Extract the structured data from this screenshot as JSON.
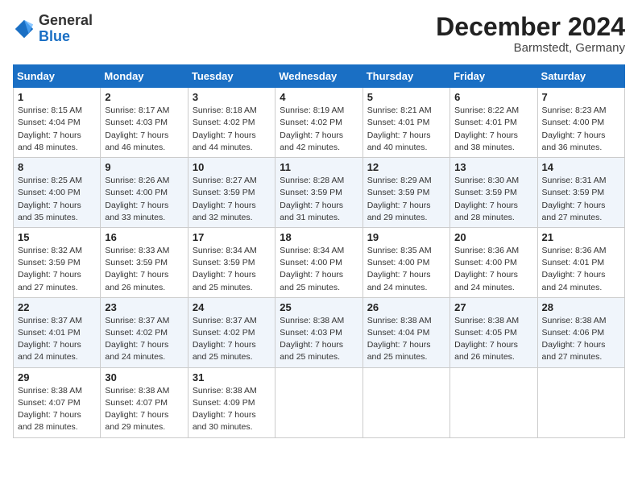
{
  "header": {
    "logo_general": "General",
    "logo_blue": "Blue",
    "month_title": "December 2024",
    "location": "Barmstedt, Germany"
  },
  "columns": [
    "Sunday",
    "Monday",
    "Tuesday",
    "Wednesday",
    "Thursday",
    "Friday",
    "Saturday"
  ],
  "weeks": [
    [
      {
        "day": "1",
        "sunrise": "Sunrise: 8:15 AM",
        "sunset": "Sunset: 4:04 PM",
        "daylight": "Daylight: 7 hours and 48 minutes."
      },
      {
        "day": "2",
        "sunrise": "Sunrise: 8:17 AM",
        "sunset": "Sunset: 4:03 PM",
        "daylight": "Daylight: 7 hours and 46 minutes."
      },
      {
        "day": "3",
        "sunrise": "Sunrise: 8:18 AM",
        "sunset": "Sunset: 4:02 PM",
        "daylight": "Daylight: 7 hours and 44 minutes."
      },
      {
        "day": "4",
        "sunrise": "Sunrise: 8:19 AM",
        "sunset": "Sunset: 4:02 PM",
        "daylight": "Daylight: 7 hours and 42 minutes."
      },
      {
        "day": "5",
        "sunrise": "Sunrise: 8:21 AM",
        "sunset": "Sunset: 4:01 PM",
        "daylight": "Daylight: 7 hours and 40 minutes."
      },
      {
        "day": "6",
        "sunrise": "Sunrise: 8:22 AM",
        "sunset": "Sunset: 4:01 PM",
        "daylight": "Daylight: 7 hours and 38 minutes."
      },
      {
        "day": "7",
        "sunrise": "Sunrise: 8:23 AM",
        "sunset": "Sunset: 4:00 PM",
        "daylight": "Daylight: 7 hours and 36 minutes."
      }
    ],
    [
      {
        "day": "8",
        "sunrise": "Sunrise: 8:25 AM",
        "sunset": "Sunset: 4:00 PM",
        "daylight": "Daylight: 7 hours and 35 minutes."
      },
      {
        "day": "9",
        "sunrise": "Sunrise: 8:26 AM",
        "sunset": "Sunset: 4:00 PM",
        "daylight": "Daylight: 7 hours and 33 minutes."
      },
      {
        "day": "10",
        "sunrise": "Sunrise: 8:27 AM",
        "sunset": "Sunset: 3:59 PM",
        "daylight": "Daylight: 7 hours and 32 minutes."
      },
      {
        "day": "11",
        "sunrise": "Sunrise: 8:28 AM",
        "sunset": "Sunset: 3:59 PM",
        "daylight": "Daylight: 7 hours and 31 minutes."
      },
      {
        "day": "12",
        "sunrise": "Sunrise: 8:29 AM",
        "sunset": "Sunset: 3:59 PM",
        "daylight": "Daylight: 7 hours and 29 minutes."
      },
      {
        "day": "13",
        "sunrise": "Sunrise: 8:30 AM",
        "sunset": "Sunset: 3:59 PM",
        "daylight": "Daylight: 7 hours and 28 minutes."
      },
      {
        "day": "14",
        "sunrise": "Sunrise: 8:31 AM",
        "sunset": "Sunset: 3:59 PM",
        "daylight": "Daylight: 7 hours and 27 minutes."
      }
    ],
    [
      {
        "day": "15",
        "sunrise": "Sunrise: 8:32 AM",
        "sunset": "Sunset: 3:59 PM",
        "daylight": "Daylight: 7 hours and 27 minutes."
      },
      {
        "day": "16",
        "sunrise": "Sunrise: 8:33 AM",
        "sunset": "Sunset: 3:59 PM",
        "daylight": "Daylight: 7 hours and 26 minutes."
      },
      {
        "day": "17",
        "sunrise": "Sunrise: 8:34 AM",
        "sunset": "Sunset: 3:59 PM",
        "daylight": "Daylight: 7 hours and 25 minutes."
      },
      {
        "day": "18",
        "sunrise": "Sunrise: 8:34 AM",
        "sunset": "Sunset: 4:00 PM",
        "daylight": "Daylight: 7 hours and 25 minutes."
      },
      {
        "day": "19",
        "sunrise": "Sunrise: 8:35 AM",
        "sunset": "Sunset: 4:00 PM",
        "daylight": "Daylight: 7 hours and 24 minutes."
      },
      {
        "day": "20",
        "sunrise": "Sunrise: 8:36 AM",
        "sunset": "Sunset: 4:00 PM",
        "daylight": "Daylight: 7 hours and 24 minutes."
      },
      {
        "day": "21",
        "sunrise": "Sunrise: 8:36 AM",
        "sunset": "Sunset: 4:01 PM",
        "daylight": "Daylight: 7 hours and 24 minutes."
      }
    ],
    [
      {
        "day": "22",
        "sunrise": "Sunrise: 8:37 AM",
        "sunset": "Sunset: 4:01 PM",
        "daylight": "Daylight: 7 hours and 24 minutes."
      },
      {
        "day": "23",
        "sunrise": "Sunrise: 8:37 AM",
        "sunset": "Sunset: 4:02 PM",
        "daylight": "Daylight: 7 hours and 24 minutes."
      },
      {
        "day": "24",
        "sunrise": "Sunrise: 8:37 AM",
        "sunset": "Sunset: 4:02 PM",
        "daylight": "Daylight: 7 hours and 25 minutes."
      },
      {
        "day": "25",
        "sunrise": "Sunrise: 8:38 AM",
        "sunset": "Sunset: 4:03 PM",
        "daylight": "Daylight: 7 hours and 25 minutes."
      },
      {
        "day": "26",
        "sunrise": "Sunrise: 8:38 AM",
        "sunset": "Sunset: 4:04 PM",
        "daylight": "Daylight: 7 hours and 25 minutes."
      },
      {
        "day": "27",
        "sunrise": "Sunrise: 8:38 AM",
        "sunset": "Sunset: 4:05 PM",
        "daylight": "Daylight: 7 hours and 26 minutes."
      },
      {
        "day": "28",
        "sunrise": "Sunrise: 8:38 AM",
        "sunset": "Sunset: 4:06 PM",
        "daylight": "Daylight: 7 hours and 27 minutes."
      }
    ],
    [
      {
        "day": "29",
        "sunrise": "Sunrise: 8:38 AM",
        "sunset": "Sunset: 4:07 PM",
        "daylight": "Daylight: 7 hours and 28 minutes."
      },
      {
        "day": "30",
        "sunrise": "Sunrise: 8:38 AM",
        "sunset": "Sunset: 4:07 PM",
        "daylight": "Daylight: 7 hours and 29 minutes."
      },
      {
        "day": "31",
        "sunrise": "Sunrise: 8:38 AM",
        "sunset": "Sunset: 4:09 PM",
        "daylight": "Daylight: 7 hours and 30 minutes."
      },
      null,
      null,
      null,
      null
    ]
  ]
}
